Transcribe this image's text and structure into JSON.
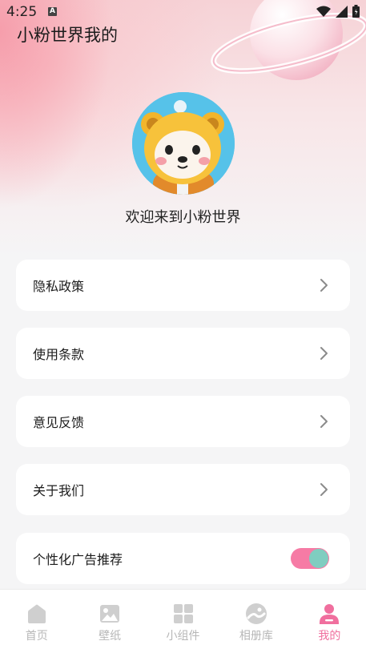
{
  "status_bar": {
    "time": "4:25",
    "notification_icon": "a-icon",
    "icons": [
      "wifi-icon",
      "signal-icon",
      "battery-icon"
    ]
  },
  "header": {
    "title": "小粉世界我的"
  },
  "profile": {
    "avatar": "bear-avatar",
    "welcome_text": "欢迎来到小粉世界"
  },
  "menu": [
    {
      "label": "隐私政策",
      "icon": "chevron-right-icon"
    },
    {
      "label": "使用条款",
      "icon": "chevron-right-icon"
    },
    {
      "label": "意见反馈",
      "icon": "chevron-right-icon"
    },
    {
      "label": "关于我们",
      "icon": "chevron-right-icon"
    }
  ],
  "ad_setting": {
    "label": "个性化广告推荐",
    "enabled": true
  },
  "tabbar": {
    "items": [
      {
        "label": "首页",
        "icon": "home-icon",
        "active": false
      },
      {
        "label": "壁纸",
        "icon": "image-icon",
        "active": false
      },
      {
        "label": "小组件",
        "icon": "widgets-icon",
        "active": false
      },
      {
        "label": "相册库",
        "icon": "album-icon",
        "active": false
      },
      {
        "label": "我的",
        "icon": "profile-icon",
        "active": true
      }
    ]
  },
  "colors": {
    "accent": "#f06f9e",
    "toggle_track": "#f67ba5",
    "toggle_knob": "#7fcdc0",
    "inactive_tab": "#b7b7b7"
  }
}
